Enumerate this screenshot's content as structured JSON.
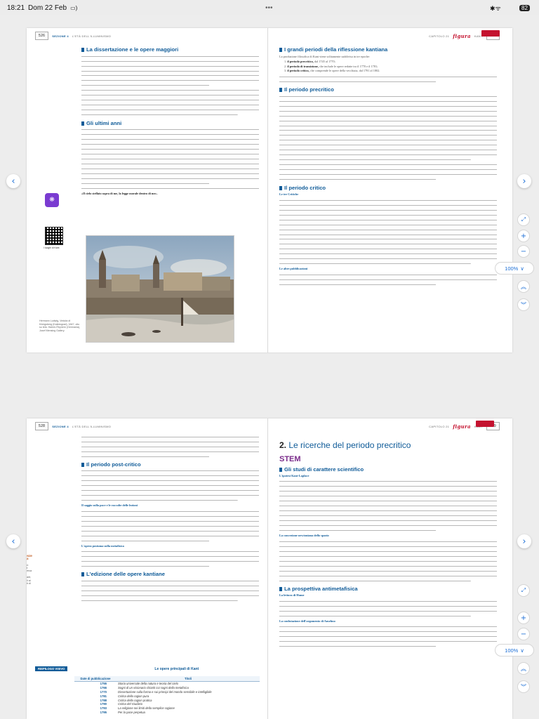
{
  "status": {
    "time": "18:21",
    "date": "Dom 22 Feb",
    "dots": "•••",
    "battery": "82"
  },
  "viewer": {
    "zoom": "100%",
    "zoom_chevron": "∨"
  },
  "s1": {
    "left": {
      "page_num": "526",
      "section": "SEZIONE 4",
      "section_title": "L'ETÀ DELL'ILLUMINISMO",
      "h_dissertazione": "La dissertazione e le opere maggiori",
      "h_ultimi": "Gli ultimi anni",
      "quote": "«Il cielo stellato sopra di me, la legge morale dentro di me».",
      "caption": "Hermann Ludwig, Veduta di Königsberg (Kaliningrad), 1847, olio su tela. Hamm-Rhynern (Germania), Josef Mensing Gallery.",
      "qr_label": "I luoghi di Kant"
    },
    "right": {
      "page_num": "527",
      "chapter": "CAPITOLO 21",
      "brand": "figura",
      "chapter_title": "KANT",
      "h_grandi": "I grandi periodi della riflessione kantiana",
      "intro": "La produzione filosofica di Kant viene solitamente suddivisa in tre epoche:",
      "period_list": [
        {
          "n": "1.",
          "lead": "il periodo precritico,",
          "rest": "dal 1745 al 1770;"
        },
        {
          "n": "2.",
          "lead": "il periodo di transizione,",
          "rest": "che include le opere redatte tra il 1770 e il 1781;"
        },
        {
          "n": "3.",
          "lead": "il periodo critico,",
          "rest": "che comprende le opere della vecchiaia, dal 1781 al 1802."
        }
      ],
      "h_precritico": "Il periodo precritico",
      "h_critico": "Il periodo critico",
      "lead_tre": "Le tre Critiche",
      "lead_altre": "Le altre pubblicazioni"
    }
  },
  "s2": {
    "left": {
      "page_num": "528",
      "section": "SEZIONE 4",
      "section_title": "L'ETÀ DELL'ILLUMINISMO",
      "h_post": "Il periodo post-critico",
      "lead_saggio": "Il saggio sulla pace e le raccolte delle lezioni",
      "lead_opus": "L'opera postuma sulla metafisica",
      "h_edizione": "L'edizione delle opere kantiane",
      "side_title": "Conoscenze alla prova",
      "side_text": "• Compila un elenco degli ambiti di ricerca di cui si è occupato Kant, associandoli ai diversi scritti di riferimento.",
      "table": {
        "tag": "RIEPILOGO VISIVO",
        "title": "Le opere principali di Kant",
        "headers": [
          "Date di pubblicazione",
          "Titoli"
        ],
        "rows": [
          [
            "1755",
            "Storia universale della natura e teoria del cielo"
          ],
          [
            "1766",
            "Sogni di un visionario chiariti coi sogni della metafisica"
          ],
          [
            "1770",
            "Dissertazione sulla forma e sui principi del mondo sensibile e intelligibile"
          ],
          [
            "1781",
            "Critica della ragion pura"
          ],
          [
            "1788",
            "Critica della ragion pratica"
          ],
          [
            "1790",
            "Critica del Giudizio"
          ],
          [
            "1793",
            "La religione nei limiti della semplice ragione"
          ],
          [
            "1795",
            "Per la pace perpetua"
          ]
        ]
      }
    },
    "right": {
      "page_num": "529",
      "chapter": "CAPITOLO 21",
      "brand": "figura",
      "chapter_title": "KANT",
      "chapter_no": "2.",
      "chapter_heading": "Le ricerche del periodo precritico",
      "stem": "STEM",
      "h_studi": "Gli studi di carattere scientifico",
      "lead_ipotesi": "L'ipotesi Kant-Laplace",
      "lead_newton": "La concezione newtoniana dello spazio",
      "h_antimeta": "La prospettiva antimetafisica",
      "lead_hume": "La lettura di Hume",
      "lead_anselmo": "La confutazione dell'argomento di Anselmo"
    }
  }
}
